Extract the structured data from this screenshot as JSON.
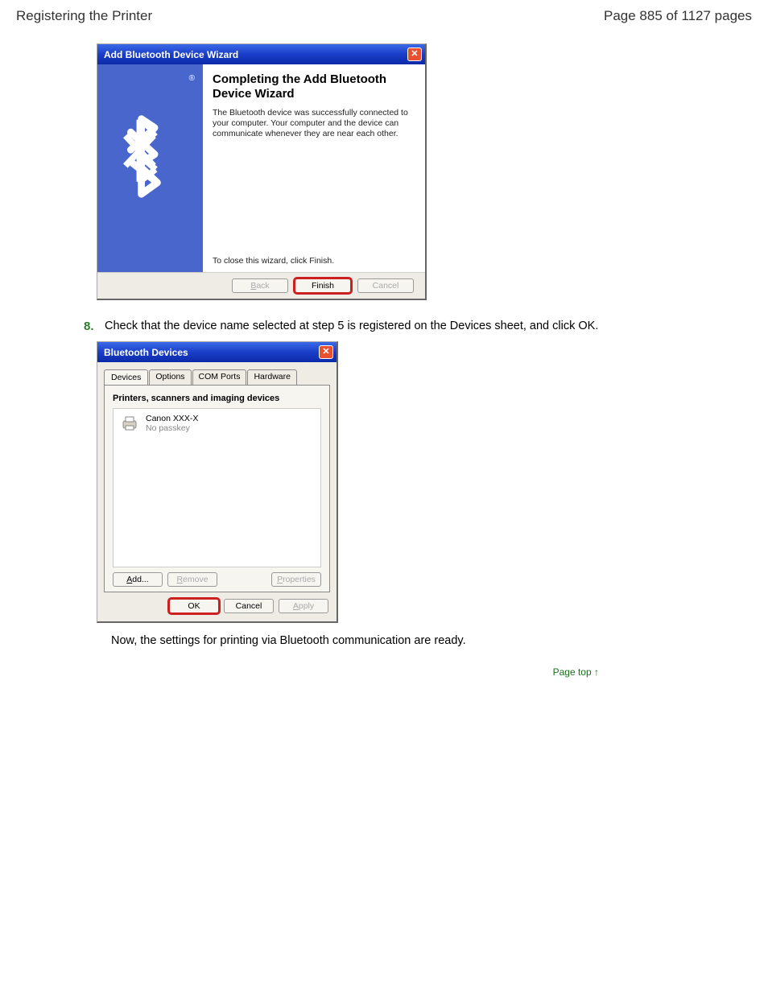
{
  "header": {
    "title": "Registering the Printer",
    "page_info": "Page 885 of 1127 pages"
  },
  "wizard": {
    "title": "Add Bluetooth Device Wizard",
    "heading": "Completing the Add Bluetooth Device Wizard",
    "body_text": "The Bluetooth device was successfully connected to your computer. Your computer and the device can communicate whenever they are near each other.",
    "close_text": "To close this wizard, click Finish.",
    "back_btn": "< Back",
    "finish_btn": "Finish",
    "cancel_btn": "Cancel"
  },
  "step": {
    "num": "8.",
    "text": "Check that the device name selected at step 5 is registered on the Devices sheet, and click OK."
  },
  "devices": {
    "title": "Bluetooth Devices",
    "tabs": {
      "t1": "Devices",
      "t2": "Options",
      "t3": "COM Ports",
      "t4": "Hardware"
    },
    "group": "Printers, scanners and imaging devices",
    "device_name": "Canon XXX-X",
    "device_meta": "No passkey",
    "add_btn": "Add...",
    "remove_btn": "Remove",
    "props_btn": "Properties",
    "ok_btn": "OK",
    "cancel_btn": "Cancel",
    "apply_btn": "Apply"
  },
  "note": "Now, the settings for printing via Bluetooth communication are ready.",
  "page_top": "Page top"
}
